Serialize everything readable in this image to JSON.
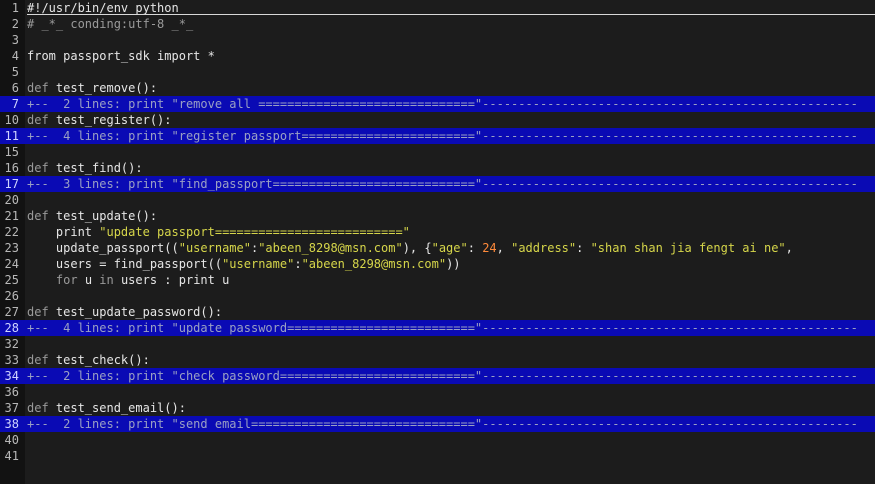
{
  "editor": {
    "lines": [
      {
        "n": "1",
        "segs": [
          [
            "tx",
            "#!/usr/bin/env python"
          ]
        ]
      },
      {
        "n": "2",
        "segs": [
          [
            "cm",
            "# _*_ conding:utf-8 _*_"
          ]
        ]
      },
      {
        "n": "3",
        "segs": []
      },
      {
        "n": "4",
        "segs": [
          [
            "tx",
            "from passport_sdk import *"
          ]
        ]
      },
      {
        "n": "5",
        "segs": []
      },
      {
        "n": "6",
        "segs": [
          [
            "kw",
            "def"
          ],
          [
            "tx",
            " test_remove():"
          ]
        ]
      },
      {
        "n": "7",
        "fold": true,
        "segs": [
          [
            "tx",
            "+--  2 lines: print \"remove all ==============================\"----------------------------------------------------"
          ]
        ]
      },
      {
        "n": "10",
        "segs": [
          [
            "kw",
            "def"
          ],
          [
            "tx",
            " test_register():"
          ]
        ]
      },
      {
        "n": "11",
        "fold": true,
        "segs": [
          [
            "tx",
            "+--  4 lines: print \"register passport========================\"----------------------------------------------------"
          ]
        ]
      },
      {
        "n": "15",
        "segs": []
      },
      {
        "n": "16",
        "segs": [
          [
            "kw",
            "def"
          ],
          [
            "tx",
            " test_find():"
          ]
        ]
      },
      {
        "n": "17",
        "fold": true,
        "segs": [
          [
            "tx",
            "+--  3 lines: print \"find_passport============================\"----------------------------------------------------"
          ]
        ]
      },
      {
        "n": "20",
        "segs": []
      },
      {
        "n": "21",
        "segs": [
          [
            "kw",
            "def"
          ],
          [
            "tx",
            " test_update():"
          ]
        ]
      },
      {
        "n": "22",
        "segs": [
          [
            "tx",
            "    print "
          ],
          [
            "st",
            "\"update passport==========================\""
          ]
        ]
      },
      {
        "n": "23",
        "segs": [
          [
            "tx",
            "    update_passport(("
          ],
          [
            "st",
            "\"username\""
          ],
          [
            "tx",
            ":"
          ],
          [
            "st",
            "\"abeen_8298@msn.com\""
          ],
          [
            "tx",
            "), {"
          ],
          [
            "st",
            "\"age\""
          ],
          [
            "tx",
            ": "
          ],
          [
            "nm",
            "24"
          ],
          [
            "tx",
            ", "
          ],
          [
            "st",
            "\"address\""
          ],
          [
            "tx",
            ": "
          ],
          [
            "st",
            "\"shan shan jia fengt ai ne\""
          ],
          [
            "tx",
            ","
          ]
        ]
      },
      {
        "n": "24",
        "segs": [
          [
            "tx",
            "    users = find_passport(("
          ],
          [
            "st",
            "\"username\""
          ],
          [
            "tx",
            ":"
          ],
          [
            "st",
            "\"abeen_8298@msn.com\""
          ],
          [
            "tx",
            "))"
          ]
        ]
      },
      {
        "n": "25",
        "segs": [
          [
            "tx",
            "    "
          ],
          [
            "kw",
            "for"
          ],
          [
            "tx",
            " u "
          ],
          [
            "kw",
            "in"
          ],
          [
            "tx",
            " users : print u"
          ]
        ]
      },
      {
        "n": "26",
        "segs": []
      },
      {
        "n": "27",
        "segs": [
          [
            "kw",
            "def"
          ],
          [
            "tx",
            " test_update_password():"
          ]
        ]
      },
      {
        "n": "28",
        "fold": true,
        "segs": [
          [
            "tx",
            "+--  4 lines: print \"update password==========================\"----------------------------------------------------"
          ]
        ]
      },
      {
        "n": "32",
        "segs": []
      },
      {
        "n": "33",
        "segs": [
          [
            "kw",
            "def"
          ],
          [
            "tx",
            " test_check():"
          ]
        ]
      },
      {
        "n": "34",
        "fold": true,
        "segs": [
          [
            "tx",
            "+--  2 lines: print \"check password===========================\"----------------------------------------------------"
          ]
        ]
      },
      {
        "n": "36",
        "segs": []
      },
      {
        "n": "37",
        "segs": [
          [
            "kw",
            "def"
          ],
          [
            "tx",
            " test_send_email():"
          ]
        ]
      },
      {
        "n": "38",
        "fold": true,
        "segs": [
          [
            "tx",
            "+--  2 lines: print \"send email===============================\"----------------------------------------------------"
          ]
        ]
      },
      {
        "n": "40",
        "segs": []
      },
      {
        "n": "41",
        "segs": []
      }
    ]
  }
}
